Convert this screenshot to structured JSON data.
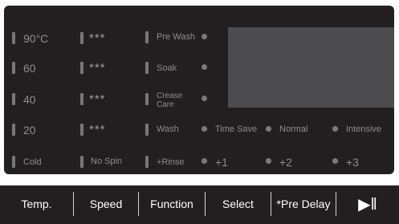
{
  "temperature": {
    "options": [
      "90°C",
      "60",
      "40",
      "20",
      "Cold"
    ]
  },
  "speed": {
    "options": [
      "***",
      "***",
      "***",
      "***",
      "No Spin"
    ]
  },
  "function": {
    "options": [
      "Pre Wash",
      "Soak",
      "Crease Care",
      "Wash",
      "+Rinse"
    ]
  },
  "wash_modes": [
    "Time Save",
    "Normal",
    "Intensive"
  ],
  "rinse_levels": [
    "+1",
    "+2",
    "+3"
  ],
  "buttons": {
    "temp": "Temp.",
    "speed": "Speed",
    "function": "Function",
    "select": "Select",
    "pre_delay": "*Pre Delay",
    "start_pause": "▶‖"
  },
  "colors": {
    "panel_bg": "#231f20",
    "label_gray": "#8d8d91",
    "screen_gray": "#4c4c50",
    "button_text": "#ffffff"
  }
}
